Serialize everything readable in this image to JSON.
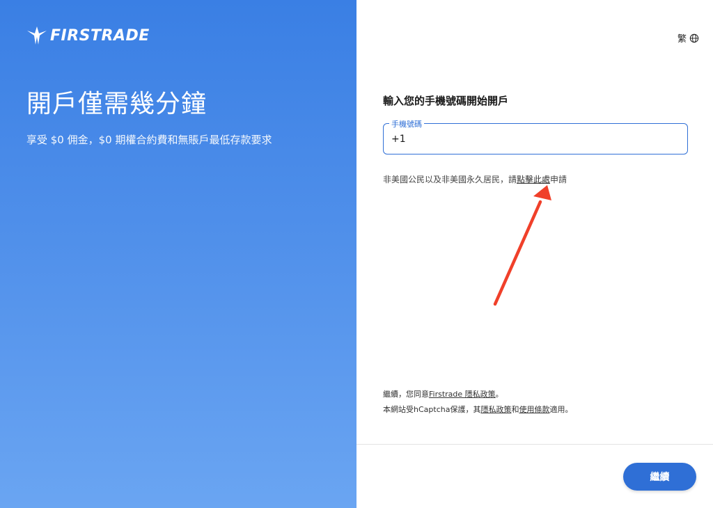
{
  "brand": {
    "name": "FIRSTRADE",
    "logo_icon": "firstrade-logo-icon"
  },
  "hero": {
    "title": "開戶僅需幾分鐘",
    "subtitle": "享受 $0 佣金，$0 期權合約費和無賬戶最低存款要求"
  },
  "language": {
    "label": "繁",
    "icon": "globe-icon"
  },
  "form": {
    "title": "輸入您的手機號碼開始開戶",
    "phone_label": "手機號碼",
    "phone_value": "+1"
  },
  "notice": {
    "prefix": "非美國公民以及非美國永久居民，請",
    "link": "點擊此處",
    "suffix": "申請"
  },
  "legal": {
    "line1_prefix": "繼續，您同意",
    "line1_link": "Firstrade 隱私政策",
    "line1_suffix": "。",
    "line2_prefix": "本網站受hCaptcha保護，其",
    "line2_link1": "隱私政策",
    "line2_mid": "和",
    "line2_link2": "使用條款",
    "line2_suffix": "適用。"
  },
  "actions": {
    "continue_label": "繼續"
  },
  "colors": {
    "accent": "#2f6fd6",
    "annotation_arrow": "#f0402a"
  }
}
